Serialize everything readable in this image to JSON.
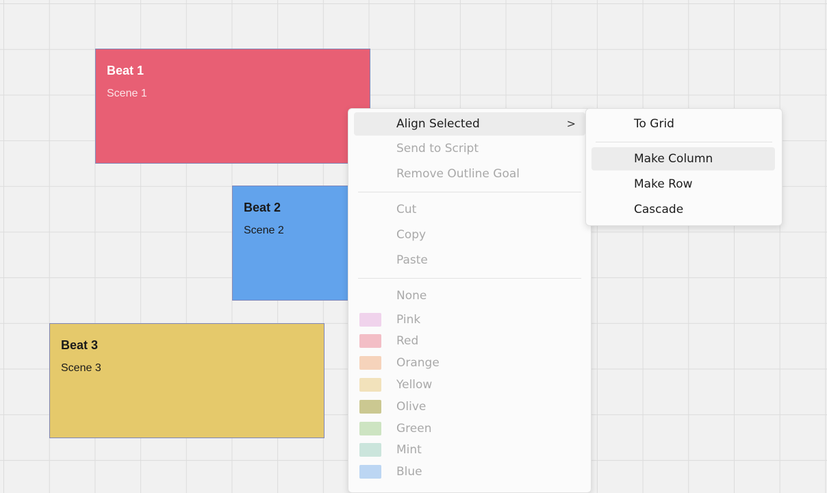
{
  "canvas": {
    "cards": [
      {
        "title": "Beat 1",
        "subtitle": "Scene 1",
        "color": "#e85f74"
      },
      {
        "title": "Beat 2",
        "subtitle": "Scene 2",
        "color": "#62a3ec"
      },
      {
        "title": "Beat 3",
        "subtitle": "Scene 3",
        "color": "#e5c96b"
      }
    ]
  },
  "context_menu": {
    "align_selected": "Align Selected",
    "align_chevron": ">",
    "send_to_script": "Send to Script",
    "remove_outline_goal": "Remove Outline Goal",
    "cut": "Cut",
    "copy": "Copy",
    "paste": "Paste",
    "none": "None",
    "colors": [
      {
        "label": "Pink",
        "swatch": "#f0d3ec"
      },
      {
        "label": "Red",
        "swatch": "#f3bec6"
      },
      {
        "label": "Orange",
        "swatch": "#f6d3bb"
      },
      {
        "label": "Yellow",
        "swatch": "#f2e2bb"
      },
      {
        "label": "Olive",
        "swatch": "#cbc891"
      },
      {
        "label": "Green",
        "swatch": "#cde4c2"
      },
      {
        "label": "Mint",
        "swatch": "#cbe5dc"
      },
      {
        "label": "Blue",
        "swatch": "#bcd6f3"
      }
    ]
  },
  "align_submenu": {
    "to_grid": "To Grid",
    "make_column": "Make Column",
    "make_row": "Make Row",
    "cascade": "Cascade"
  }
}
